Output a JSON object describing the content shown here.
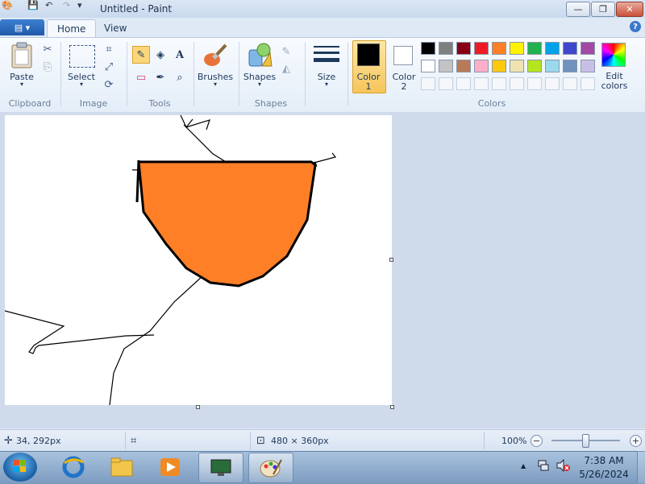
{
  "window": {
    "title": "Untitled - Paint",
    "controls": {
      "minimize": "—",
      "maximize": "❐",
      "close": "✕"
    }
  },
  "quick_access": {
    "save": "💾",
    "undo": "↶",
    "redo": "↷",
    "customize": "▾"
  },
  "tabs": {
    "file_menu": "▤ ▾",
    "home": "Home",
    "view": "View"
  },
  "help": "?",
  "ribbon": {
    "clipboard": {
      "group": "Clipboard",
      "paste": "Paste",
      "paste_arrow": "▾",
      "cut_icon": "✂",
      "copy_icon": "⎘"
    },
    "image": {
      "group": "Image",
      "select": "Select",
      "select_arrow": "▾",
      "crop_icon": "⌗",
      "resize_icon": "⤢",
      "rotate_icon": "⟳"
    },
    "tools": {
      "group": "Tools",
      "pencil": "✎",
      "fill": "◈",
      "text": "A",
      "eraser": "▭",
      "picker": "✒",
      "magnifier": "⌕"
    },
    "brushes": {
      "label": "Brushes",
      "arrow": "▾"
    },
    "shapes": {
      "group": "Shapes",
      "label": "Shapes",
      "arrow": "▾",
      "outline_icon": "✎",
      "fill_icon": "◭"
    },
    "size": {
      "label": "Size",
      "arrow": "▾"
    },
    "colors": {
      "group": "Colors",
      "color1": "Color",
      "color1_num": "1",
      "color2": "Color",
      "color2_num": "2",
      "edit_colors": "Edit colors",
      "color1_value": "#000000",
      "color2_value": "#ffffff",
      "palette_row1": [
        "#000000",
        "#7f7f7f",
        "#880015",
        "#ed1c24",
        "#ff7f27",
        "#fff200",
        "#22b14c",
        "#00a2e8",
        "#3f48cc",
        "#a349a4"
      ],
      "palette_row2": [
        "#ffffff",
        "#c3c3c3",
        "#b97a57",
        "#ffaec9",
        "#ffc90e",
        "#efe4b0",
        "#b5e61d",
        "#99d9ea",
        "#7092be",
        "#c8bfe7"
      ],
      "palette_row3": [
        "#f5f7fa",
        "#f5f7fa",
        "#f5f7fa",
        "#f5f7fa",
        "#f5f7fa",
        "#f5f7fa",
        "#f5f7fa",
        "#f5f7fa",
        "#f5f7fa",
        "#f5f7fa"
      ]
    }
  },
  "canvas": {
    "fill_color": "#ff7f27",
    "stroke_color": "#000000"
  },
  "status": {
    "cursor_pos": "34, 292px",
    "selection_size": "",
    "image_size": "480 × 360px",
    "zoom": "100%",
    "zoom_minus": "−",
    "zoom_plus": "+"
  },
  "taskbar": {
    "time": "7:38 AM",
    "date": "5/26/2024",
    "tray_up": "▲"
  }
}
